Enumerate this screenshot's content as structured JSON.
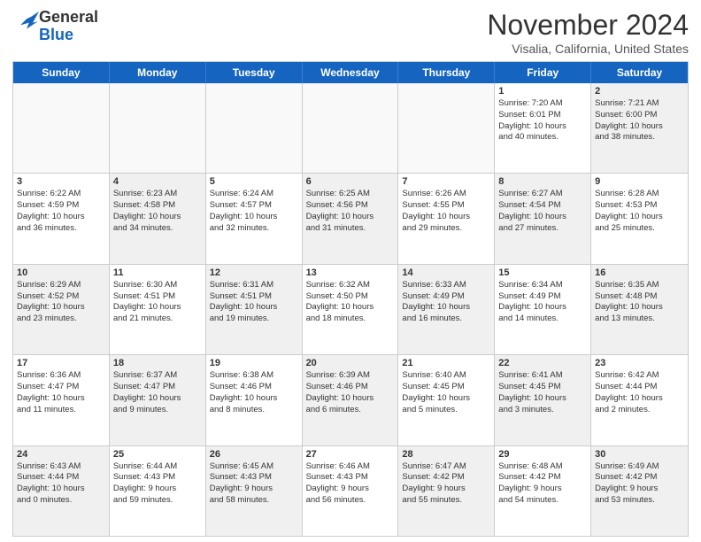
{
  "logo": {
    "line1": "General",
    "line2": "Blue"
  },
  "title": "November 2024",
  "location": "Visalia, California, United States",
  "header_days": [
    "Sunday",
    "Monday",
    "Tuesday",
    "Wednesday",
    "Thursday",
    "Friday",
    "Saturday"
  ],
  "rows": [
    [
      {
        "day": "",
        "info": "",
        "shaded": false,
        "empty": true
      },
      {
        "day": "",
        "info": "",
        "shaded": false,
        "empty": true
      },
      {
        "day": "",
        "info": "",
        "shaded": false,
        "empty": true
      },
      {
        "day": "",
        "info": "",
        "shaded": false,
        "empty": true
      },
      {
        "day": "",
        "info": "",
        "shaded": false,
        "empty": true
      },
      {
        "day": "1",
        "info": "Sunrise: 7:20 AM\nSunset: 6:01 PM\nDaylight: 10 hours\nand 40 minutes.",
        "shaded": false,
        "empty": false
      },
      {
        "day": "2",
        "info": "Sunrise: 7:21 AM\nSunset: 6:00 PM\nDaylight: 10 hours\nand 38 minutes.",
        "shaded": true,
        "empty": false
      }
    ],
    [
      {
        "day": "3",
        "info": "Sunrise: 6:22 AM\nSunset: 4:59 PM\nDaylight: 10 hours\nand 36 minutes.",
        "shaded": false,
        "empty": false
      },
      {
        "day": "4",
        "info": "Sunrise: 6:23 AM\nSunset: 4:58 PM\nDaylight: 10 hours\nand 34 minutes.",
        "shaded": true,
        "empty": false
      },
      {
        "day": "5",
        "info": "Sunrise: 6:24 AM\nSunset: 4:57 PM\nDaylight: 10 hours\nand 32 minutes.",
        "shaded": false,
        "empty": false
      },
      {
        "day": "6",
        "info": "Sunrise: 6:25 AM\nSunset: 4:56 PM\nDaylight: 10 hours\nand 31 minutes.",
        "shaded": true,
        "empty": false
      },
      {
        "day": "7",
        "info": "Sunrise: 6:26 AM\nSunset: 4:55 PM\nDaylight: 10 hours\nand 29 minutes.",
        "shaded": false,
        "empty": false
      },
      {
        "day": "8",
        "info": "Sunrise: 6:27 AM\nSunset: 4:54 PM\nDaylight: 10 hours\nand 27 minutes.",
        "shaded": true,
        "empty": false
      },
      {
        "day": "9",
        "info": "Sunrise: 6:28 AM\nSunset: 4:53 PM\nDaylight: 10 hours\nand 25 minutes.",
        "shaded": false,
        "empty": false
      }
    ],
    [
      {
        "day": "10",
        "info": "Sunrise: 6:29 AM\nSunset: 4:52 PM\nDaylight: 10 hours\nand 23 minutes.",
        "shaded": true,
        "empty": false
      },
      {
        "day": "11",
        "info": "Sunrise: 6:30 AM\nSunset: 4:51 PM\nDaylight: 10 hours\nand 21 minutes.",
        "shaded": false,
        "empty": false
      },
      {
        "day": "12",
        "info": "Sunrise: 6:31 AM\nSunset: 4:51 PM\nDaylight: 10 hours\nand 19 minutes.",
        "shaded": true,
        "empty": false
      },
      {
        "day": "13",
        "info": "Sunrise: 6:32 AM\nSunset: 4:50 PM\nDaylight: 10 hours\nand 18 minutes.",
        "shaded": false,
        "empty": false
      },
      {
        "day": "14",
        "info": "Sunrise: 6:33 AM\nSunset: 4:49 PM\nDaylight: 10 hours\nand 16 minutes.",
        "shaded": true,
        "empty": false
      },
      {
        "day": "15",
        "info": "Sunrise: 6:34 AM\nSunset: 4:49 PM\nDaylight: 10 hours\nand 14 minutes.",
        "shaded": false,
        "empty": false
      },
      {
        "day": "16",
        "info": "Sunrise: 6:35 AM\nSunset: 4:48 PM\nDaylight: 10 hours\nand 13 minutes.",
        "shaded": true,
        "empty": false
      }
    ],
    [
      {
        "day": "17",
        "info": "Sunrise: 6:36 AM\nSunset: 4:47 PM\nDaylight: 10 hours\nand 11 minutes.",
        "shaded": false,
        "empty": false
      },
      {
        "day": "18",
        "info": "Sunrise: 6:37 AM\nSunset: 4:47 PM\nDaylight: 10 hours\nand 9 minutes.",
        "shaded": true,
        "empty": false
      },
      {
        "day": "19",
        "info": "Sunrise: 6:38 AM\nSunset: 4:46 PM\nDaylight: 10 hours\nand 8 minutes.",
        "shaded": false,
        "empty": false
      },
      {
        "day": "20",
        "info": "Sunrise: 6:39 AM\nSunset: 4:46 PM\nDaylight: 10 hours\nand 6 minutes.",
        "shaded": true,
        "empty": false
      },
      {
        "day": "21",
        "info": "Sunrise: 6:40 AM\nSunset: 4:45 PM\nDaylight: 10 hours\nand 5 minutes.",
        "shaded": false,
        "empty": false
      },
      {
        "day": "22",
        "info": "Sunrise: 6:41 AM\nSunset: 4:45 PM\nDaylight: 10 hours\nand 3 minutes.",
        "shaded": true,
        "empty": false
      },
      {
        "day": "23",
        "info": "Sunrise: 6:42 AM\nSunset: 4:44 PM\nDaylight: 10 hours\nand 2 minutes.",
        "shaded": false,
        "empty": false
      }
    ],
    [
      {
        "day": "24",
        "info": "Sunrise: 6:43 AM\nSunset: 4:44 PM\nDaylight: 10 hours\nand 0 minutes.",
        "shaded": true,
        "empty": false
      },
      {
        "day": "25",
        "info": "Sunrise: 6:44 AM\nSunset: 4:43 PM\nDaylight: 9 hours\nand 59 minutes.",
        "shaded": false,
        "empty": false
      },
      {
        "day": "26",
        "info": "Sunrise: 6:45 AM\nSunset: 4:43 PM\nDaylight: 9 hours\nand 58 minutes.",
        "shaded": true,
        "empty": false
      },
      {
        "day": "27",
        "info": "Sunrise: 6:46 AM\nSunset: 4:43 PM\nDaylight: 9 hours\nand 56 minutes.",
        "shaded": false,
        "empty": false
      },
      {
        "day": "28",
        "info": "Sunrise: 6:47 AM\nSunset: 4:42 PM\nDaylight: 9 hours\nand 55 minutes.",
        "shaded": true,
        "empty": false
      },
      {
        "day": "29",
        "info": "Sunrise: 6:48 AM\nSunset: 4:42 PM\nDaylight: 9 hours\nand 54 minutes.",
        "shaded": false,
        "empty": false
      },
      {
        "day": "30",
        "info": "Sunrise: 6:49 AM\nSunset: 4:42 PM\nDaylight: 9 hours\nand 53 minutes.",
        "shaded": true,
        "empty": false
      }
    ]
  ]
}
